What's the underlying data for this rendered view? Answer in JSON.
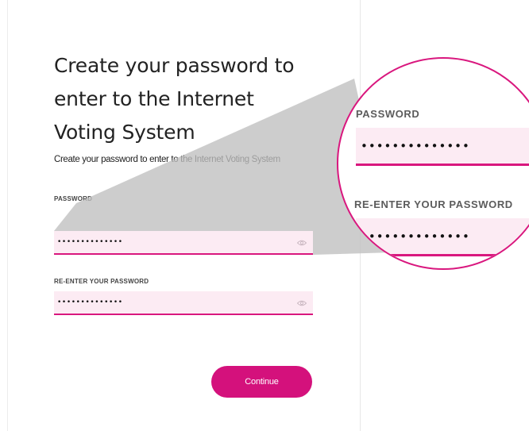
{
  "page": {
    "title": "Create your password to enter to the Internet Voting System",
    "subtitle": "Create your password to enter to the Internet Voting System"
  },
  "form": {
    "password": {
      "label": "PASSWORD",
      "value": "••••••••••••••"
    },
    "reenter_password": {
      "label": "RE-ENTER YOUR PASSWORD",
      "value": "••••••••••••••"
    },
    "continue_label": "Continue"
  },
  "magnifier": {
    "password_label": "PASSWORD",
    "password_value": "••••••••••••••",
    "reenter_label": "RE-ENTER YOUR PASSWORD",
    "reenter_value": "••••••••••••••"
  },
  "icons": {
    "visibility_toggle": "eye-icon"
  },
  "colors": {
    "accent": "#d4117c",
    "field_background": "#fcebf3",
    "callout_shade": "#c4c4c4"
  }
}
